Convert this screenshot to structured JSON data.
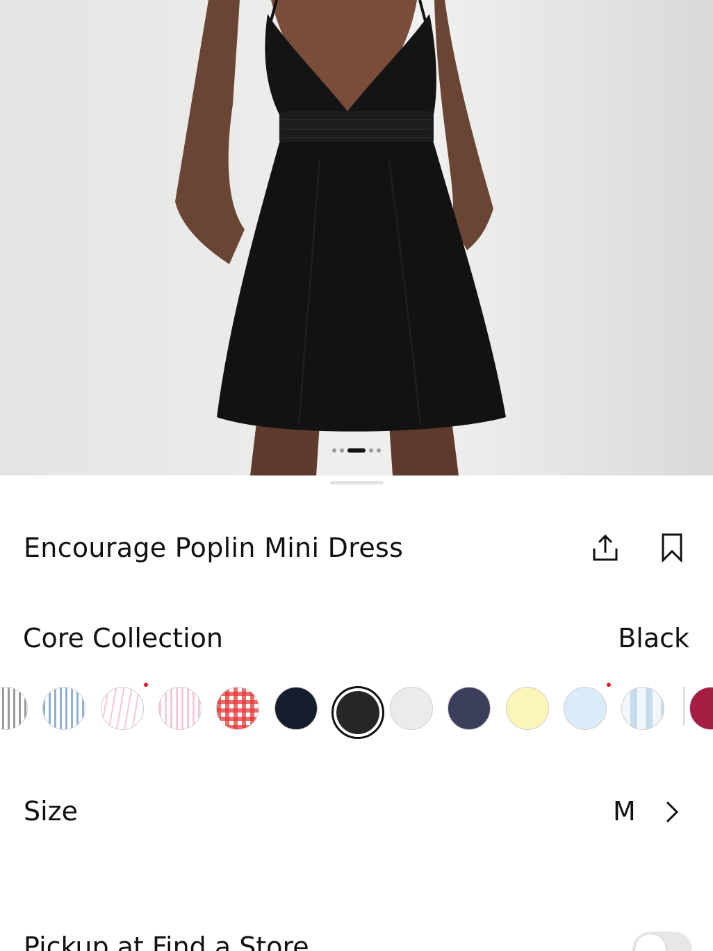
{
  "product": {
    "title": "Encourage Poplin Mini Dress",
    "collection": "Core Collection",
    "selected_color": "Black"
  },
  "gallery": {
    "image_count": 5,
    "active_index": 2
  },
  "actions": {
    "share_icon": "share-icon",
    "save_icon": "bookmark-icon"
  },
  "swatches": [
    {
      "name": "grey-stripe",
      "colors": [
        "#9a9a9a",
        "#ffffff"
      ],
      "pattern": "vstripe"
    },
    {
      "name": "blue-stripe",
      "colors": [
        "#8eb0d6",
        "#ffffff"
      ],
      "pattern": "vstripe"
    },
    {
      "name": "pink-stripe",
      "colors": [
        "#f5c7d6",
        "#ffffff"
      ],
      "pattern": "diag",
      "new": true
    },
    {
      "name": "pink-pinstripe",
      "colors": [
        "#f6c9dd",
        "#ffffff"
      ],
      "pattern": "vstripe"
    },
    {
      "name": "red-gingham",
      "colors": [
        "#e53a3a",
        "#ffffff"
      ],
      "pattern": "gingham"
    },
    {
      "name": "navy",
      "colors": [
        "#161d2c"
      ],
      "pattern": "solid"
    },
    {
      "name": "black",
      "colors": [
        "#262626"
      ],
      "pattern": "solid",
      "selected": true
    },
    {
      "name": "white",
      "colors": [
        "#ebebeb"
      ],
      "pattern": "solid"
    },
    {
      "name": "dark-navy",
      "colors": [
        "#3c3f5c"
      ],
      "pattern": "solid"
    },
    {
      "name": "pale-yellow",
      "colors": [
        "#faf5b9"
      ],
      "pattern": "solid"
    },
    {
      "name": "light-blue",
      "colors": [
        "#d9ecf8"
      ],
      "pattern": "solid",
      "new": true
    },
    {
      "name": "blue-wide-stripe",
      "colors": [
        "#c6dcec",
        "#f3f7fa"
      ],
      "pattern": "wide"
    },
    {
      "name": "burgundy",
      "colors": [
        "#a61d43"
      ],
      "pattern": "solid"
    }
  ],
  "size": {
    "label": "Size",
    "value": "M"
  },
  "pickup": {
    "label": "Pickup at Find a Store",
    "enabled": false
  },
  "colors": {
    "accent": "#111111",
    "new_indicator": "#d51c24"
  }
}
